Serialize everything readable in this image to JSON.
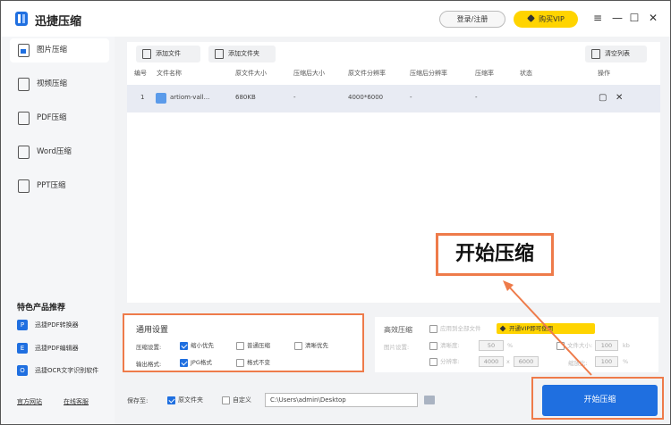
{
  "app": {
    "title": "迅捷压缩"
  },
  "titlebar": {
    "login_label": "登录/注册",
    "vip_label": "购买VIP"
  },
  "sidebar": {
    "items": [
      {
        "label": "图片压缩"
      },
      {
        "label": "视频压缩"
      },
      {
        "label": "PDF压缩"
      },
      {
        "label": "Word压缩"
      },
      {
        "label": "PPT压缩"
      }
    ],
    "featured_title": "特色产品推荐",
    "featured": [
      {
        "label": "迅捷PDF转换器"
      },
      {
        "label": "迅捷PDF编辑器"
      },
      {
        "label": "迅捷OCR文字识别软件"
      }
    ],
    "links": {
      "official": "官方网站",
      "support": "在线客服"
    }
  },
  "toolbar": {
    "add_file": "添加文件",
    "add_folder": "添加文件夹",
    "clear_list": "清空列表"
  },
  "table": {
    "headers": [
      "编号",
      "文件名称",
      "原文件大小",
      "压缩后大小",
      "原文件分辨率",
      "压缩后分辨率",
      "压缩率",
      "状态",
      "操作"
    ],
    "rows": [
      {
        "index": "1",
        "name": "artiom-vall...",
        "size": "680KB",
        "compressed_size": "-",
        "resolution": "4000*6000",
        "compressed_resolution": "-",
        "ratio": "-",
        "status": ""
      }
    ]
  },
  "settings": {
    "title": "通用设置",
    "mode_label": "压缩设置:",
    "modes": [
      {
        "label": "缩小优先",
        "checked": true
      },
      {
        "label": "普通压缩",
        "checked": false
      },
      {
        "label": "清晰优先",
        "checked": false
      }
    ],
    "format_label": "输出格式:",
    "formats": [
      {
        "label": "JPG格式",
        "checked": true
      },
      {
        "label": "格式不变",
        "checked": false
      }
    ]
  },
  "efficient": {
    "title": "高效压缩",
    "apply_all": "应用到全部文件",
    "vip_badge": "开通VIP即可使用",
    "image_setting_label": "图片设置:",
    "clarity_label": "清晰度:",
    "clarity_value": "50",
    "clarity_unit": "%",
    "resolution_label": "分辨率:",
    "width_value": "4000",
    "times": "x",
    "height_value": "6000",
    "filesize_label": "文件大小:",
    "filesize_value": "100",
    "filesize_unit": "kb",
    "scale_label": "缩放比:",
    "scale_value": "100",
    "scale_unit": "%"
  },
  "bottom": {
    "save_to_label": "保存至:",
    "source_folder": "原文件夹",
    "custom": "自定义",
    "path": "C:\\Users\\admin\\Desktop",
    "start_button": "开始压缩"
  },
  "callout": {
    "text": "开始压缩"
  },
  "colors": {
    "accent": "#1f6fe0",
    "highlight": "#ee7b4a",
    "vip": "#ffd400"
  }
}
